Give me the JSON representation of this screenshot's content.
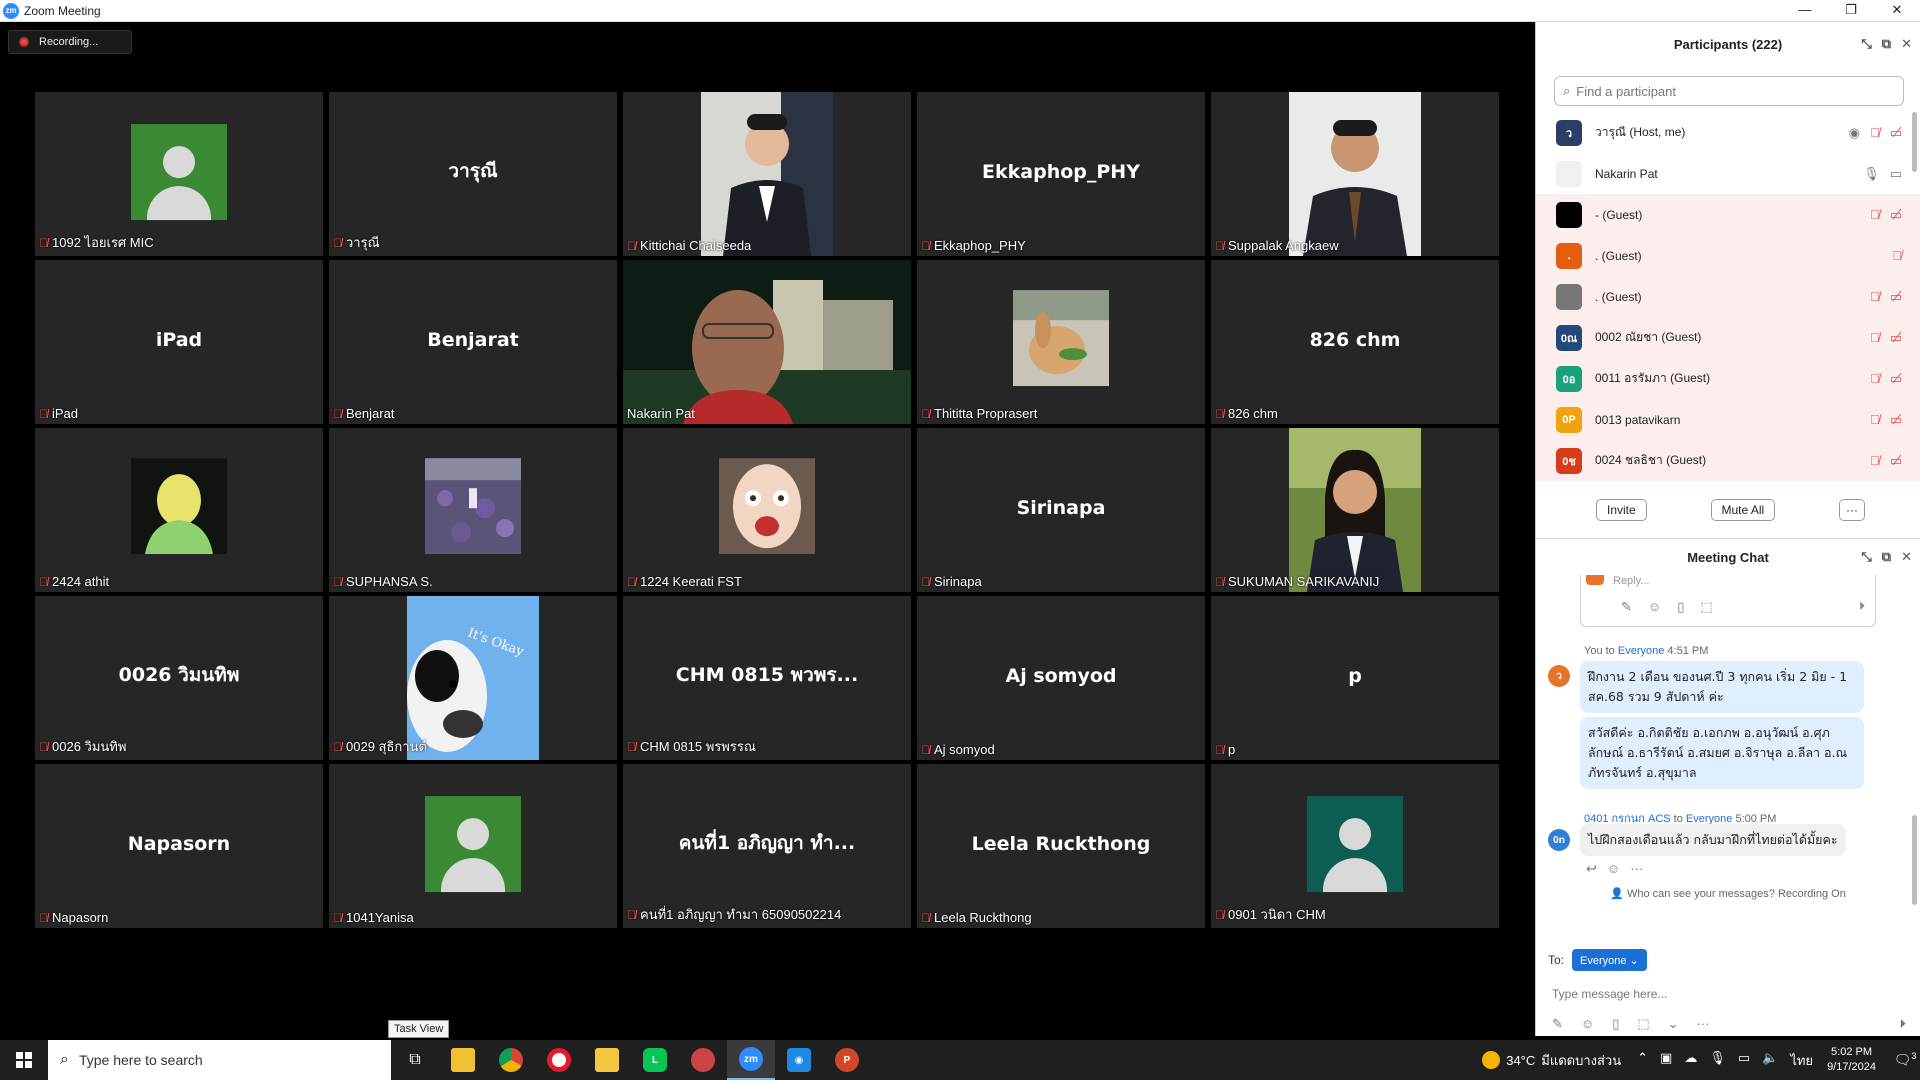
{
  "window": {
    "title": "Zoom Meeting",
    "controls": [
      "—",
      "❐",
      "✕"
    ]
  },
  "recording": {
    "label": "Recording..."
  },
  "tiles": [
    {
      "big": "",
      "label": "1092 ไอยเรศ MIC",
      "kind": "avatar",
      "bg": "#3a8a34"
    },
    {
      "big": "วารุณี",
      "label": "วารุณี",
      "kind": "name"
    },
    {
      "big": "",
      "label": "Kittichai Chaiseeda",
      "kind": "photo",
      "photo": "suit"
    },
    {
      "big": "Ekkaphop_PHY",
      "label": "Ekkaphop_PHY",
      "kind": "name"
    },
    {
      "big": "",
      "label": "Suppalak Angkaew",
      "kind": "photo",
      "photo": "suit2"
    },
    {
      "big": "iPad",
      "label": "iPad",
      "kind": "name"
    },
    {
      "big": "Benjarat",
      "label": "Benjarat",
      "kind": "name"
    },
    {
      "big": "",
      "label": "Nakarin Pat",
      "kind": "video",
      "active": true
    },
    {
      "big": "",
      "label": "Thititta Proprasert",
      "kind": "square",
      "photo": "rabbit"
    },
    {
      "big": "826 chm",
      "label": "826 chm",
      "kind": "name"
    },
    {
      "big": "",
      "label": "2424 athit",
      "kind": "square",
      "photo": "green"
    },
    {
      "big": "",
      "label": "SUPHANSA S.",
      "kind": "square",
      "photo": "flowers"
    },
    {
      "big": "",
      "label": "1224 Keerati FST",
      "kind": "square",
      "photo": "face"
    },
    {
      "big": "Sirinapa",
      "label": "Sirinapa",
      "kind": "name"
    },
    {
      "big": "",
      "label": "SUKUMAN SARIKAVANIJ",
      "kind": "photo",
      "photo": "woman"
    },
    {
      "big": "0026 วิมนทิพ",
      "label": "0026 วิมนทิพ",
      "kind": "name"
    },
    {
      "big": "",
      "label": "0029 สุธิกานต์",
      "kind": "photo",
      "photo": "cow"
    },
    {
      "big": "CHM 0815 พวพร...",
      "label": "CHM 0815 พรพรรณ",
      "kind": "name"
    },
    {
      "big": "Aj somyod",
      "label": "Aj somyod",
      "kind": "name"
    },
    {
      "big": "p",
      "label": "p",
      "kind": "name"
    },
    {
      "big": "Napasorn",
      "label": "Napasorn",
      "kind": "name"
    },
    {
      "big": "",
      "label": "1041Yanisa",
      "kind": "avatar",
      "bg": "#3a8a34"
    },
    {
      "big": "คนที่1 อภิญญา ทำ...",
      "label": "คนที่1 อภิญญา ทำมา 65090502214",
      "kind": "name"
    },
    {
      "big": "Leela Ruckthong",
      "label": "Leela Ruckthong",
      "kind": "name"
    },
    {
      "big": "",
      "label": "0901 วนิดา CHM",
      "kind": "avatar",
      "bg": "#0d5e52"
    }
  ],
  "participants": {
    "title": "Participants (222)",
    "search_placeholder": "Find a participant",
    "items": [
      {
        "name": "วารุณี (Host, me)",
        "initial": "ว",
        "color": "#2c3e66",
        "hl": false,
        "icons": [
          "◉",
          "mic",
          "cam"
        ]
      },
      {
        "name": "Nakarin Pat",
        "initial": "",
        "color": "#f0f0f0",
        "hl": false,
        "icons": [
          "🎙",
          "▭"
        ]
      },
      {
        "name": "- (Guest)",
        "initial": "",
        "color": "#000000",
        "hl": true,
        "icons": [
          "mic",
          "cam"
        ]
      },
      {
        "name": ". (Guest)",
        "initial": ".",
        "color": "#e55d0f",
        "hl": true,
        "icons": [
          "mic"
        ]
      },
      {
        "name": ". (Guest)",
        "initial": "",
        "color": "#777777",
        "hl": true,
        "icons": [
          "mic",
          "cam"
        ]
      },
      {
        "name": "0002 ณัยชา (Guest)",
        "initial": "0ณ",
        "color": "#24487a",
        "hl": true,
        "icons": [
          "mic",
          "cam"
        ]
      },
      {
        "name": "0011 อรรัมภา (Guest)",
        "initial": "0อ",
        "color": "#1aa37a",
        "hl": true,
        "icons": [
          "mic",
          "cam"
        ]
      },
      {
        "name": "0013 patavikarn",
        "initial": "0P",
        "color": "#f0a30a",
        "hl": true,
        "icons": [
          "mic",
          "cam"
        ]
      },
      {
        "name": "0024 ชลธิชา (Guest)",
        "initial": "0ช",
        "color": "#d63b1a",
        "hl": true,
        "icons": [
          "mic",
          "cam"
        ]
      }
    ],
    "invite": "Invite",
    "mute_all": "Mute All",
    "more": "···"
  },
  "chat": {
    "title": "Meeting Chat",
    "reply_placeholder": "Reply...",
    "msg1_sender": "You",
    "msg1_to_word": "to",
    "msg1_to": "Everyone",
    "msg1_time": "4:51 PM",
    "msg1_text_a": "ฝึกงาน 2 เดือน ของนศ.ปี 3 ทุกคน  เริ่ม 2 มิย - 1 สค.68 รวม 9 สัปดาห์ ค่ะ",
    "msg1_text_b": "สวัสดีค่ะ อ.กิตติชัย อ.เอกภพ อ.อนุวัฒน์ อ.ศุภลักษณ์ อ.ธารีรัตน์ อ.สมยศ อ.จิราษุล อ.ลีลา อ.ณภัทรจันทร์ อ.สุขุมาล",
    "msg1_avatar": "ว",
    "msg2_sender": "0401 กรกนก ACS",
    "msg2_to_word": "to",
    "msg2_to": "Everyone",
    "msg2_time": "5:00 PM",
    "msg2_text": "ไปฝึกสองเดือนแล้ว กลับมาฝึกที่ไทยต่อได้มั้ยคะ",
    "msg2_avatar": "0n",
    "who_can_see": "Who can see your messages? Recording On",
    "to_label": "To:",
    "to_value": "Everyone ⌄",
    "type_placeholder": "Type message here..."
  },
  "taskbar": {
    "tooltip": "Task View",
    "search": "Type here to search",
    "temp": "34°C",
    "weather_text": "มีแดดบางส่วน",
    "lang": "ไทย",
    "time": "5:02 PM",
    "date": "9/17/2024",
    "notif_count": "3"
  }
}
